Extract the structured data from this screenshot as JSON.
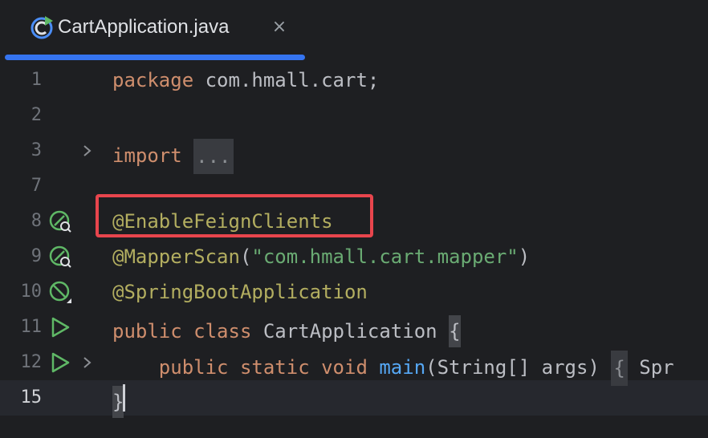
{
  "tab": {
    "title": "CartApplication.java",
    "close_glyph": "×",
    "icon": "java-class-run-icon",
    "accent_color": "#3574f0"
  },
  "gutter": {
    "lines": [
      "1",
      "2",
      "3",
      "7",
      "8",
      "9",
      "10",
      "11",
      "12",
      "15"
    ]
  },
  "code": {
    "line1": {
      "keyword": "package",
      "rest": " com.hmall.cart;"
    },
    "line3": {
      "keyword": "import",
      "folded": "..."
    },
    "line8": {
      "annotation": "@EnableFeignClients"
    },
    "line9": {
      "annotation": "@MapperScan",
      "open": "(",
      "string": "\"com.hmall.cart.mapper\"",
      "close": ")"
    },
    "line10": {
      "annotation": "@SpringBootApplication"
    },
    "line11": {
      "keyword1": "public",
      "keyword2": "class",
      "name": "CartApplication",
      "brace": "{"
    },
    "line12": {
      "keyword1": "public",
      "keyword2": "static",
      "keyword3": "void",
      "method": "main",
      "params": "(String[] args)",
      "brace": "{",
      "trail": "Spr"
    },
    "line15": {
      "brace": "}"
    }
  },
  "highlight": {
    "color": "#e8454d"
  }
}
